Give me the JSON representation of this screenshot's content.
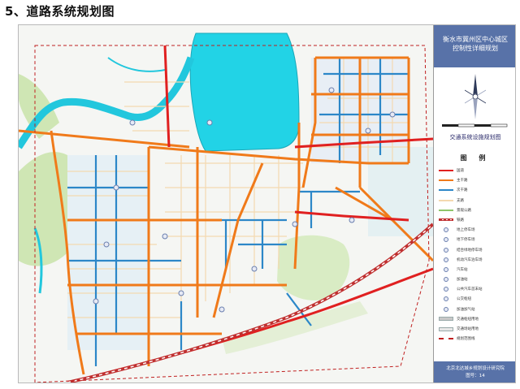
{
  "heading": "5、道路系统规划图",
  "title_block": {
    "line1": "衡水市冀州区中心城区",
    "line2": "控制性详细规划"
  },
  "compass_icon": "north-arrow",
  "subtitle": "交通系统设施规划图",
  "legend": {
    "title": "图 例",
    "items": [
      {
        "label": "国道",
        "symbol": "line",
        "color": "#e02020"
      },
      {
        "label": "主干路",
        "symbol": "line",
        "color": "#f07a1a"
      },
      {
        "label": "次干路",
        "symbol": "line",
        "color": "#2c87c8"
      },
      {
        "label": "支路",
        "symbol": "line",
        "color": "#f4d9b0"
      },
      {
        "label": "景观公路",
        "symbol": "line",
        "color": "#8fc56a"
      },
      {
        "label": "铁路",
        "symbol": "rail",
        "color": "#c03030"
      },
      {
        "label": "地上停车场",
        "symbol": "circle",
        "color": "#6a7fae"
      },
      {
        "label": "地下停车场",
        "symbol": "circle",
        "color": "#6a7fae"
      },
      {
        "label": "结合绿地停车场",
        "symbol": "circle",
        "color": "#6a7fae"
      },
      {
        "label": "机动汽车泊车场",
        "symbol": "circle",
        "color": "#6a7fae"
      },
      {
        "label": "汽车站",
        "symbol": "circle",
        "color": "#6a7fae"
      },
      {
        "label": "加油站",
        "symbol": "circle",
        "color": "#6a7fae"
      },
      {
        "label": "公共汽车首末站",
        "symbol": "circle",
        "color": "#6a7fae"
      },
      {
        "label": "公交枢纽",
        "symbol": "circle",
        "color": "#6a7fae"
      },
      {
        "label": "加油加气站",
        "symbol": "circle",
        "color": "#6a7fae"
      },
      {
        "label": "交通枢纽用地",
        "symbol": "rect",
        "color": "#c8c8c8"
      },
      {
        "label": "交通场站用地",
        "symbol": "rect",
        "color": "#e8e8e8"
      },
      {
        "label": "规划范围线",
        "symbol": "dash",
        "color": "#c02020"
      }
    ]
  },
  "footer": {
    "institute": "北京北达城乡规划设计研究院",
    "sheet_no": "图号：14"
  },
  "colors": {
    "national_road": "#e02020",
    "main_road": "#f07a1a",
    "secondary_road": "#2c87c8",
    "branch_road": "#f4d9b0",
    "water": "#22d3e6",
    "green": "#cfe6b4",
    "title_block": "#5872a8"
  }
}
